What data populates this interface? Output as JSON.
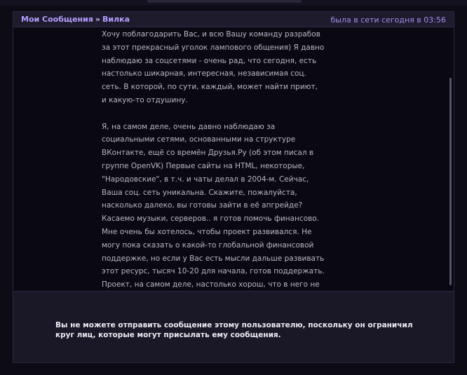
{
  "header": {
    "breadcrumb_messages": "Мои Сообщения",
    "breadcrumb_separator": "»",
    "breadcrumb_user": "Вилка",
    "online_status": "была в сети сегодня в 03:56"
  },
  "message": {
    "paragraphs": [
      "Хочу поблагодарить Вас, и всю Вашу команду разрабов за этот прекрасный уголок лампового общения) Я давно наблюдаю за соцсетями - очень рад, что сегодня, есть настолько шикарная, интересная, независимая соц. сеть. В которой, по сути, каждый, может найти приют, и какую-то отдушину.",
      "Я, на самом деле, очень давно наблюдаю за социальными сетями, основанными на структуре ВКонтакте, ещё со времён Друзья.Ру (об этом писал в группе OpenVK) Первые сайты на HTML, некоторые, \"Народовские\", в т.ч. и чаты делал в 2004-м. Сейчас, Ваша соц. сеть уникальна. Скажите, пожалуйста, насколько далеко, вы готовы зайти в её апгрейде? Касаемо музыки, серверов.. я готов помочь финансово. Мне очень бы хотелось, чтобы проект развивался. Не могу пока сказать о какой-то глобальной финансовой поддержке, но если у Вас есть мысли дальше развивать этот ресурс, тысяч 10-20 для начала, готов поддержать. Проект, на самом деле, настолько хорош, что в него не грех вложиться и больше."
    ]
  },
  "compose": {
    "notice": "Вы не можете отправить сообщение этому пользователю, поскольку он ограничил круг лиц, которые могут присылать ему сообщения."
  },
  "colors": {
    "accent": "#b69dff",
    "background": "#0a0912",
    "text": "#b9b6c4"
  }
}
